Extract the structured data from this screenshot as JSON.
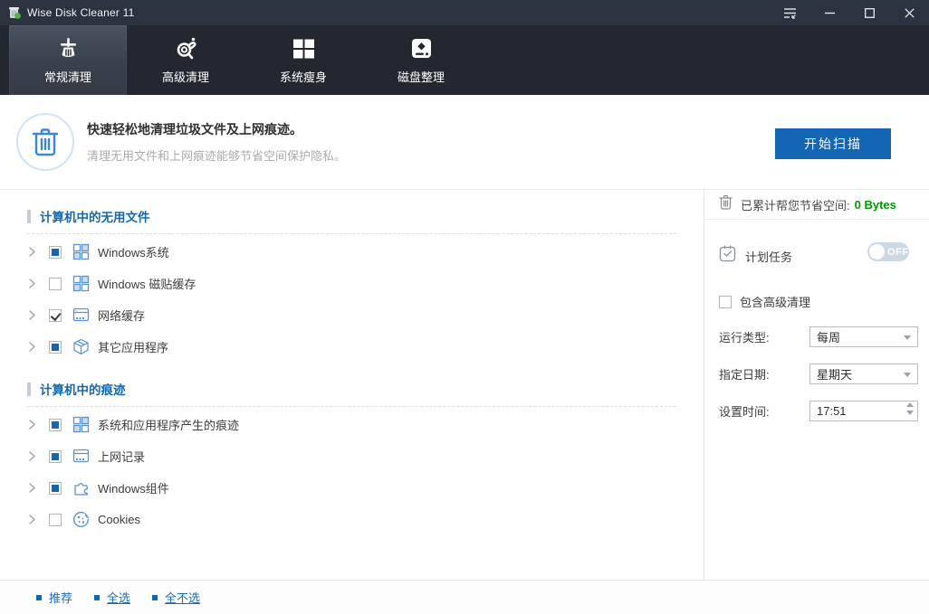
{
  "colors": {
    "accent": "#1266b4",
    "green": "#009702",
    "titlebar": "#2b3240",
    "nav": "#23272f"
  },
  "window": {
    "title": "Wise Disk Cleaner 11",
    "controls": [
      {
        "name": "menu-icon",
        "glyph": "menu"
      },
      {
        "name": "minimize-icon",
        "glyph": "minimize"
      },
      {
        "name": "maximize-icon",
        "glyph": "maximize"
      },
      {
        "name": "close-icon",
        "glyph": "close"
      }
    ]
  },
  "nav": {
    "tabs": [
      {
        "name": "tab-common-clean",
        "label": "常规清理",
        "icon": "broom-icon",
        "active": true
      },
      {
        "name": "tab-advanced-clean",
        "label": "高级清理",
        "icon": "magnifier-icon",
        "active": false
      },
      {
        "name": "tab-system-slim",
        "label": "系统瘦身",
        "icon": "windows-icon",
        "active": false
      },
      {
        "name": "tab-disk-defrag",
        "label": "磁盘整理",
        "icon": "disk-icon",
        "active": false
      }
    ]
  },
  "header": {
    "title": "快速轻松地清理垃圾文件及上网痕迹。",
    "subtitle": "清理无用文件和上网痕迹能够节省空间保护隐私。",
    "scan_button": "开始扫描",
    "icon": "trash-circle-icon"
  },
  "sections": [
    {
      "title": "计算机中的无用文件",
      "items": [
        {
          "label": "Windows系统",
          "checkbox": "partial",
          "icon": "tiles-icon"
        },
        {
          "label": "Windows 磁贴缓存",
          "checkbox": "unchecked",
          "icon": "tiles-icon"
        },
        {
          "label": "网络缓存",
          "checkbox": "checked",
          "icon": "browser-icon"
        },
        {
          "label": "其它应用程序",
          "checkbox": "partial",
          "icon": "cube-icon"
        }
      ]
    },
    {
      "title": "计算机中的痕迹",
      "items": [
        {
          "label": "系统和应用程序产生的痕迹",
          "checkbox": "partial",
          "icon": "tiles-icon"
        },
        {
          "label": "上网记录",
          "checkbox": "partial",
          "icon": "browser-icon"
        },
        {
          "label": "Windows组件",
          "checkbox": "partial",
          "icon": "puzzle-icon"
        },
        {
          "label": "Cookies",
          "checkbox": "unchecked",
          "icon": "cookie-icon"
        }
      ]
    }
  ],
  "panel": {
    "saved_label": "已累计帮您节省空间:",
    "saved_value": "0 Bytes",
    "schedule_label": "计划任务",
    "toggle_state": "OFF",
    "advanced_checkbox_label": "包含高级清理",
    "fields": [
      {
        "label": "运行类型:",
        "value": "每周",
        "type": "select",
        "name": "run-type-select"
      },
      {
        "label": "指定日期:",
        "value": "星期天",
        "type": "select",
        "name": "day-select"
      },
      {
        "label": "设置时间:",
        "value": "17:51",
        "type": "spinner",
        "name": "time-spinner"
      }
    ]
  },
  "footer": {
    "links": [
      {
        "label": "推荐",
        "name": "recommend-link",
        "underline": false
      },
      {
        "label": "全选",
        "name": "select-all-link",
        "underline": true
      },
      {
        "label": "全不选",
        "name": "deselect-all-link",
        "underline": true
      }
    ]
  }
}
